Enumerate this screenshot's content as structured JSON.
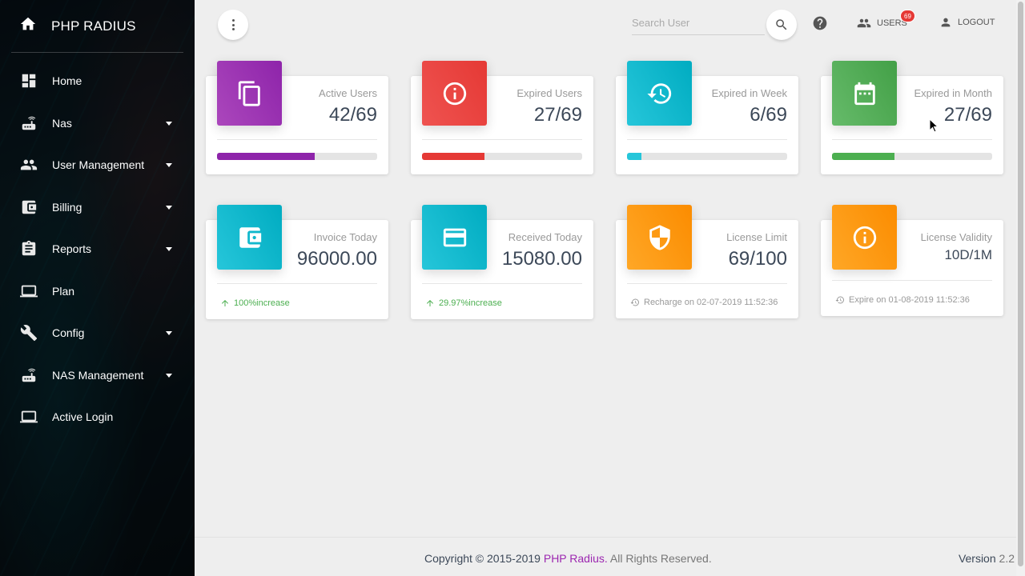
{
  "app": {
    "title": "PHP RADIUS"
  },
  "sidebar": {
    "items": [
      {
        "label": "Home",
        "icon": "dashboard-icon",
        "has_caret": false
      },
      {
        "label": "Nas",
        "icon": "router-icon",
        "has_caret": true
      },
      {
        "label": "User Management",
        "icon": "people-icon",
        "has_caret": true
      },
      {
        "label": "Billing",
        "icon": "wallet-icon",
        "has_caret": true
      },
      {
        "label": "Reports",
        "icon": "clipboard-icon",
        "has_caret": true
      },
      {
        "label": "Plan",
        "icon": "laptop-icon",
        "has_caret": false
      },
      {
        "label": "Config",
        "icon": "wrench-icon",
        "has_caret": true
      },
      {
        "label": "NAS Management",
        "icon": "router-icon",
        "has_caret": true
      },
      {
        "label": "Active Login",
        "icon": "laptop-icon",
        "has_caret": false
      }
    ]
  },
  "topbar": {
    "search_placeholder": "Search User",
    "users_label": "USERS",
    "users_badge": "69",
    "logout_label": "LOGOUT"
  },
  "cards_row1": [
    {
      "category": "Active Users",
      "value": "42",
      "total": "/69",
      "color": "#8e24aa",
      "icon": "copy-icon",
      "progress": 0.61
    },
    {
      "category": "Expired Users",
      "value": "27",
      "total": "/69",
      "color": "#e53935",
      "icon": "info-icon",
      "progress": 0.39
    },
    {
      "category": "Expired in Week",
      "value": "6",
      "total": "/69",
      "color": "#26c6da",
      "icon": "restore-icon",
      "progress": 0.09
    },
    {
      "category": "Expired in Month",
      "value": "27",
      "total": "/69",
      "color": "#4caf50",
      "icon": "calendar-icon",
      "progress": 0.39
    }
  ],
  "cards_row2": [
    {
      "category": "Invoice Today",
      "value": "96000.00",
      "color": "#26c6da",
      "icon": "wallet-icon",
      "footer": "100%increase",
      "footer_color": "#4caf50"
    },
    {
      "category": "Received Today",
      "value": "15080.00",
      "color": "#26c6da",
      "icon": "credit-card-icon",
      "footer": "29.97%increase",
      "footer_color": "#4caf50"
    },
    {
      "category": "License Limit",
      "value": "69",
      "total": "/100",
      "color": "#fb8c00",
      "icon": "shield-icon",
      "footer": "Recharge on 02-07-2019 11:52:36",
      "footer_color": "#999999"
    },
    {
      "category": "License Validity",
      "value": "10D",
      "total": "/1M",
      "color": "#fb8c00",
      "icon": "info-icon",
      "footer": "Expire on 01-08-2019 11:52:36",
      "footer_color": "#999999"
    }
  ],
  "footer": {
    "copyright_prefix": "Copyright © 2015-2019",
    "brand": "PHP Radius.",
    "suffix": "All Rights Reserved.",
    "version_label": "Version",
    "version_number": "2.2"
  }
}
